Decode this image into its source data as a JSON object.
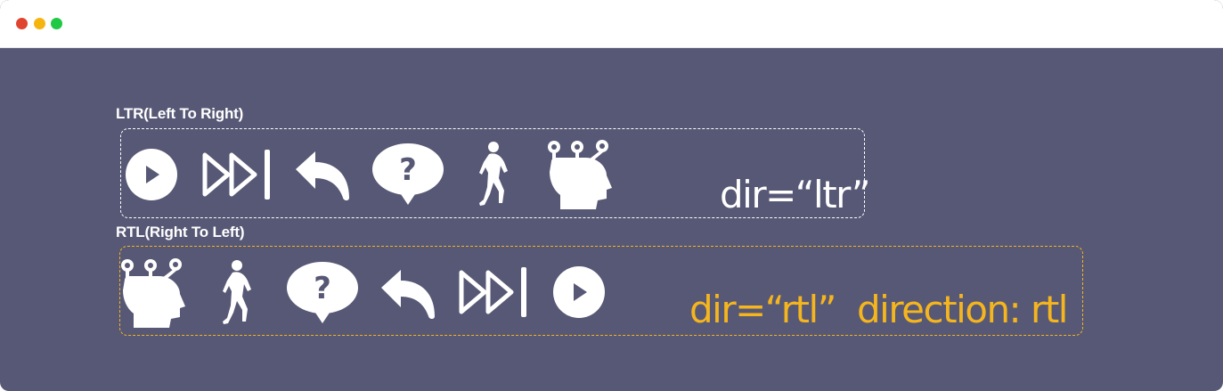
{
  "window": {
    "controls": [
      {
        "name": "close",
        "color": "#e0432f"
      },
      {
        "name": "minimize",
        "color": "#f6b40f"
      },
      {
        "name": "maximize",
        "color": "#1fc944"
      }
    ]
  },
  "ltr": {
    "label": "LTR(Left To Right)",
    "code": "dir=“ltr”",
    "icons": [
      "play-icon",
      "skip-forward-icon",
      "reply-icon",
      "help-bubble-icon",
      "runner-icon",
      "head-nodes-icon"
    ]
  },
  "rtl": {
    "label": "RTL(Right To Left)",
    "code_dir": "dir=“rtl”",
    "code_direction": "direction: rtl",
    "icons": [
      "head-nodes-icon",
      "runner-icon",
      "help-bubble-icon",
      "reply-icon",
      "skip-forward-icon",
      "play-icon"
    ]
  },
  "colors": {
    "background": "#575875",
    "accent": "#f5b51e",
    "icon": "#ffffff"
  }
}
